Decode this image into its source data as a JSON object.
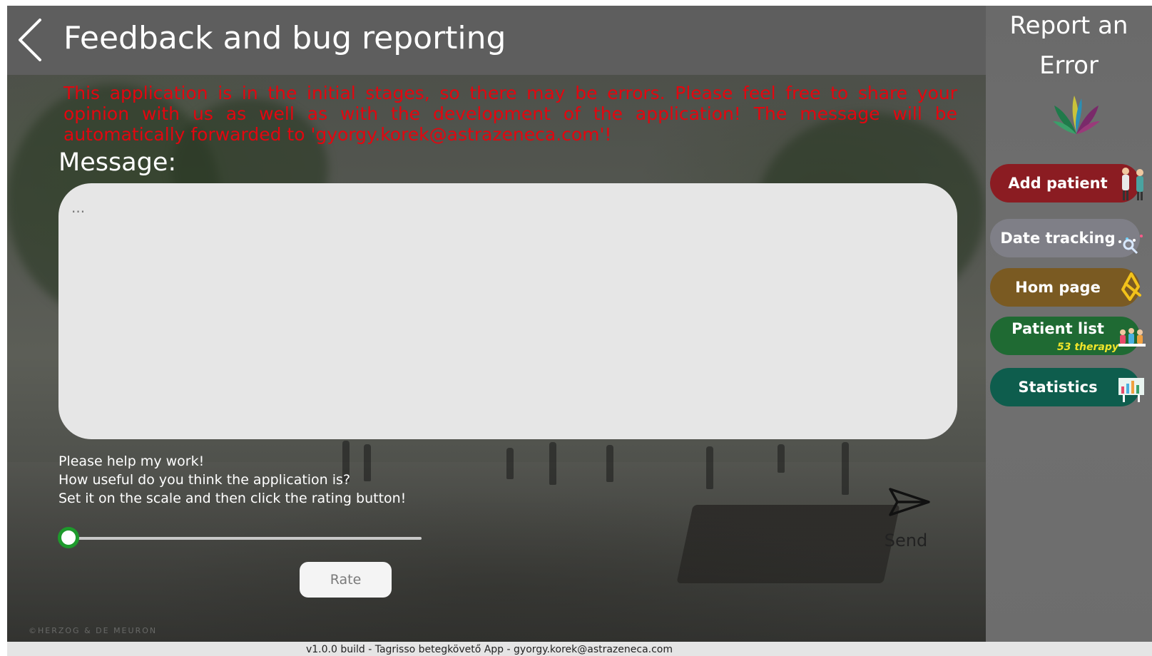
{
  "header": {
    "title": "Feedback and bug reporting"
  },
  "notice": {
    "text": "This application is in the initial stages, so there may be errors. Please feel free to share your opinion with us as well as with the development of the application! The message will be automatically forwarded to 'gyorgy.korek@astrazeneca.com'!"
  },
  "message": {
    "label": "Message:",
    "placeholder": "...",
    "value": ""
  },
  "rating": {
    "help_lines": [
      "Please help my work!",
      "How useful do you think the application is?",
      "Set it on the scale and then click the rating button!"
    ],
    "slider_value": 0,
    "button_label": "Rate"
  },
  "send": {
    "label": "Send"
  },
  "watermark": "©HERZOG & DE MEURON",
  "footer": {
    "text": "v1.0.0 build - Tagrisso betegkövető App - gyorgy.korek@astrazeneca.com"
  },
  "sidebar": {
    "title_line1": "Report an",
    "title_line2": "Error",
    "items": [
      {
        "label": "Add patient",
        "color": "#8b1c22"
      },
      {
        "label": "Date tracking",
        "color": "#7f7f87"
      },
      {
        "label": "Hom page",
        "color": "#7a5a22"
      },
      {
        "label": "Patient list",
        "sublabel": "53 therapy",
        "color": "#1f6a33"
      },
      {
        "label": "Statistics",
        "color": "#0e5d4d"
      }
    ]
  },
  "colors": {
    "notice_red": "#e3060f",
    "slider_green": "#1e9a2c",
    "header_gray": "#5f5f5f"
  }
}
